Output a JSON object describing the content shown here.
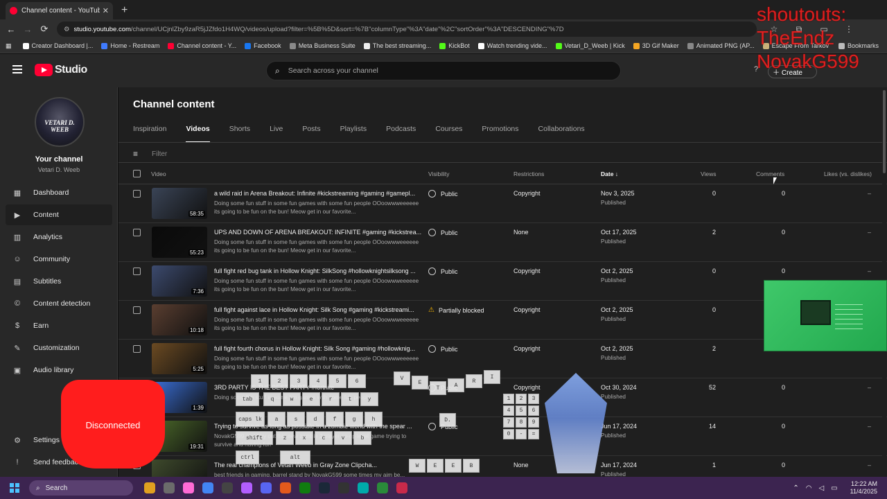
{
  "browser": {
    "tab_title": "Channel content - YouTube Stu",
    "tab_close": "✕",
    "new_tab": "+",
    "back": "←",
    "forward": "→",
    "reload": "⟳",
    "url_host": "studio.youtube.com",
    "url_path": "/channel/UCjnlZby9zaR5jJZfdo1H4WQ/videos/upload?filter=%5B%5D&sort=%7B\"columnType\"%3A\"date\"%2C\"sortOrder\"%3A\"DESCENDING\"%7D",
    "bookmarks": [
      {
        "label": "Creator Dashboard |...",
        "color": "#ffffff"
      },
      {
        "label": "Home - Restream",
        "color": "#3f7bff"
      },
      {
        "label": "Channel content - Y...",
        "color": "#ff0033"
      },
      {
        "label": "Facebook",
        "color": "#1877f2"
      },
      {
        "label": "Meta Business Suite",
        "color": "#8a8a8a"
      },
      {
        "label": "The best streaming...",
        "color": "#eeeeee"
      },
      {
        "label": "KickBot",
        "color": "#53fc18"
      },
      {
        "label": "Watch trending vide...",
        "color": "#ffffff"
      },
      {
        "label": "Vetari_D_Weeb | Kick",
        "color": "#53fc18"
      },
      {
        "label": "3D Gif Maker",
        "color": "#f5a623"
      },
      {
        "label": "Animated PNG (AP...",
        "color": "#888888"
      },
      {
        "label": "Escape From Tarkov",
        "color": "#c9b27a"
      },
      {
        "label": "Bookmarks",
        "color": "#bbbbbb"
      }
    ]
  },
  "studio": {
    "logo_text": "Studio",
    "search_placeholder": "Search across your channel",
    "create_label": "Create"
  },
  "sidebar": {
    "avatar_text": "VETARI D. WEEB",
    "channel_title": "Your channel",
    "channel_name": "Vetari D. Weeb",
    "items": [
      {
        "label": "Dashboard",
        "icon": "▦"
      },
      {
        "label": "Content",
        "icon": "▶"
      },
      {
        "label": "Analytics",
        "icon": "▥"
      },
      {
        "label": "Community",
        "icon": "☺"
      },
      {
        "label": "Subtitles",
        "icon": "▤"
      },
      {
        "label": "Content detection",
        "icon": "©"
      },
      {
        "label": "Earn",
        "icon": "$"
      },
      {
        "label": "Customization",
        "icon": "✎"
      },
      {
        "label": "Audio library",
        "icon": "▣"
      }
    ],
    "settings": "Settings",
    "send_feedback": "Send feedback"
  },
  "main": {
    "title": "Channel content",
    "tabs": [
      "Inspiration",
      "Videos",
      "Shorts",
      "Live",
      "Posts",
      "Playlists",
      "Podcasts",
      "Courses",
      "Promotions",
      "Collaborations"
    ],
    "filter_placeholder": "Filter",
    "columns": {
      "video": "Video",
      "visibility": "Visibility",
      "restrictions": "Restrictions",
      "date": "Date ↓",
      "views": "Views",
      "comments": "Comments",
      "likes": "Likes (vs. dislikes)"
    },
    "rows": [
      {
        "title": "a wild raid in Arena Breakout: Infinite #kickstreaming #gaming #gamepl...",
        "desc": "Doing some fun stuff in some fun games with some fun people OOoowwweeeeee its going to be fun on the bun! Meow get in our favorite...",
        "duration": "58:35",
        "visibility": "Public",
        "restrictions": "Copyright",
        "date": "Nov 3, 2025",
        "status": "Published",
        "views": "0",
        "comments": "0",
        "likes": "–",
        "thumb": "#3a4456"
      },
      {
        "title": "UPS AND DOWN OF ARENA BREAKOUT: INFINITE #gaming #kickstrea...",
        "desc": "Doing some fun stuff in some fun games with some fun people OOoowwweeeeee its going to be fun on the bun! Meow get in our favorite...",
        "duration": "55:23",
        "visibility": "Public",
        "restrictions": "None",
        "date": "Oct 17, 2025",
        "status": "Published",
        "views": "2",
        "comments": "0",
        "likes": "–",
        "thumb": "#0a0a0a"
      },
      {
        "title": "full fight red bug tank in Hollow Knight: SilkSong #hollowknightsilksong ...",
        "desc": "Doing some fun stuff in some fun games with some fun people OOoowwweeeeee its going to be fun on the bun! Meow get in our favorite...",
        "duration": "7:36",
        "visibility": "Public",
        "restrictions": "Copyright",
        "date": "Oct 2, 2025",
        "status": "Published",
        "views": "0",
        "comments": "0",
        "likes": "–",
        "thumb": "#3c4a6e"
      },
      {
        "title": "full fight against lace in Hollow Knight: Silk Song #gaming #kickstreami...",
        "desc": "Doing some fun stuff in some fun games with some fun people OOoowwweeeeee its going to be fun on the bun! Meow get in our favorite...",
        "duration": "10:18",
        "visibility": "Partially blocked",
        "restrictions": "Copyright",
        "date": "Oct 2, 2025",
        "status": "Published",
        "views": "0",
        "comments": "",
        "likes": "",
        "thumb": "#5a3e30"
      },
      {
        "title": "full fight fourth chorus in Hollow Knight: Silk Song #gaming #hollowknig...",
        "desc": "Doing some fun stuff in some fun games with some fun people OOoowwweeeeee its going to be fun on the bun! Meow get in our favorite...",
        "duration": "5:25",
        "visibility": "Public",
        "restrictions": "Copyright",
        "date": "Oct 2, 2025",
        "status": "Published",
        "views": "2",
        "comments": "",
        "likes": "–",
        "thumb": "#6b4a22"
      },
      {
        "title": "3RD PARTY IS THE BEST PARTY #fortnite",
        "desc": "Doing some fun stuff in some fun games with some fun people",
        "duration": "1:39",
        "visibility": "Public",
        "restrictions": "Copyright",
        "date": "Oct 30, 2024",
        "status": "Published",
        "views": "52",
        "comments": "0",
        "likes": "–",
        "thumb": "#3a6fd8"
      },
      {
        "title": "Trying to survive as long as possible in a zombie world with the spear ...",
        "desc": "NovakG599 and I try out this new zombie 2 player co-op level game trying to survive and having fun",
        "duration": "19:31",
        "visibility": "Public",
        "restrictions": "",
        "date": "Jun 17, 2024",
        "status": "Published",
        "views": "14",
        "comments": "0",
        "likes": "–",
        "thumb": "#4c6a2a"
      },
      {
        "title": "The real champions of Vetari Weeb in Gray Zone Clipcha...",
        "desc": "best friends in gaming, barrel stand by NovakG599 some times my aim be...",
        "duration": "",
        "visibility": "",
        "restrictions": "None",
        "date": "Jun 17, 2024",
        "status": "Published",
        "views": "1",
        "comments": "0",
        "likes": "–",
        "thumb": "#3e4a2c"
      }
    ]
  },
  "overlays": {
    "shoutouts": [
      "shoutouts:",
      "TheEndz",
      "NovakG599"
    ],
    "controller_status": "Disconnected",
    "keys_row1": [
      "1",
      "2",
      "3",
      "4",
      "5",
      "6"
    ],
    "keys_row2": [
      "tab",
      "q",
      "w",
      "e",
      "r",
      "t",
      "y"
    ],
    "keys_row3": [
      "caps lk",
      "a",
      "s",
      "d",
      "f",
      "g",
      "h"
    ],
    "keys_row4": [
      "shift",
      "z",
      "x",
      "c",
      "v",
      "b"
    ],
    "keys_row5": [
      "ctrl",
      "alt"
    ],
    "keys_float": [
      "V",
      "E",
      "T",
      "A",
      "R",
      "I",
      "D.",
      "W",
      "E",
      "E",
      "B"
    ],
    "numpad": [
      "1",
      "2",
      "3",
      "4",
      "5",
      "6",
      "7",
      "8",
      "9",
      "0",
      "-",
      "="
    ]
  },
  "taskbar": {
    "search": "Search",
    "time": "12:22 AM",
    "date": "11/4/2025",
    "apps": [
      "#e0a020",
      "#6b6b6b",
      "#ff6bd5",
      "#4285f4",
      "#444",
      "#b25eff",
      "#5865f2",
      "#e25a1c",
      "#107c10",
      "#1b2838",
      "#333",
      "#0aa",
      "#2a8a3a",
      "#c82a4a"
    ]
  }
}
